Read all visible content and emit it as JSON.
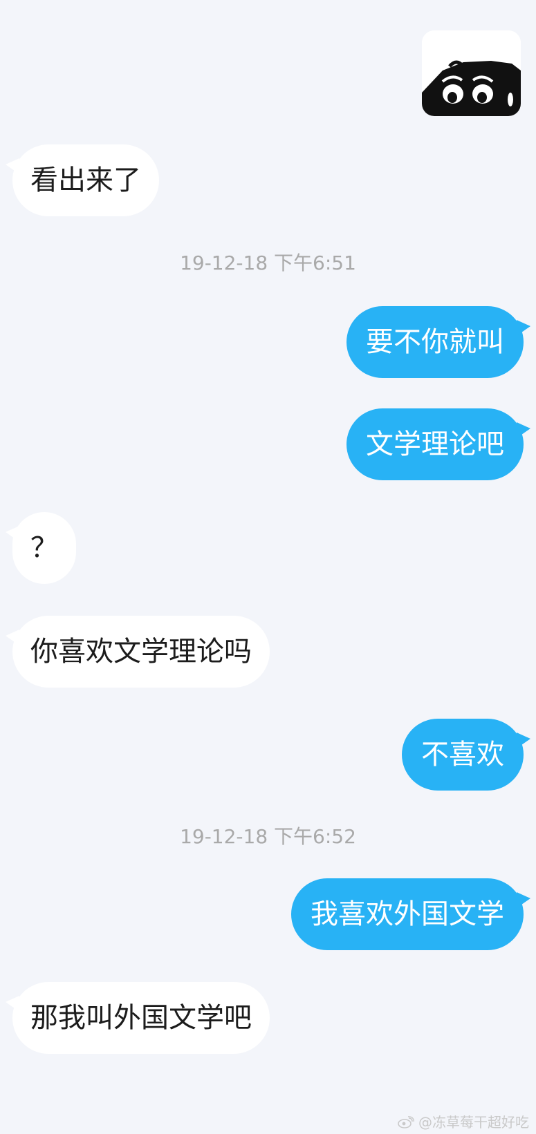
{
  "messages": {
    "m1": "看出来了",
    "ts1": "19-12-18 下午6:51",
    "m2": "要不你就叫",
    "m3": "文学理论吧",
    "m4": "？",
    "m5": "你喜欢文学理论吗",
    "m6": "不喜欢",
    "ts2": "19-12-18 下午6:52",
    "m7": "我喜欢外国文学",
    "m8": "那我叫外国文学吧"
  },
  "watermark": "@冻草莓干超好吃",
  "colors": {
    "background": "#f3f5fa",
    "incoming_bubble": "#ffffff",
    "outgoing_bubble": "#28b2f5",
    "timestamp": "#a9a9a9"
  }
}
